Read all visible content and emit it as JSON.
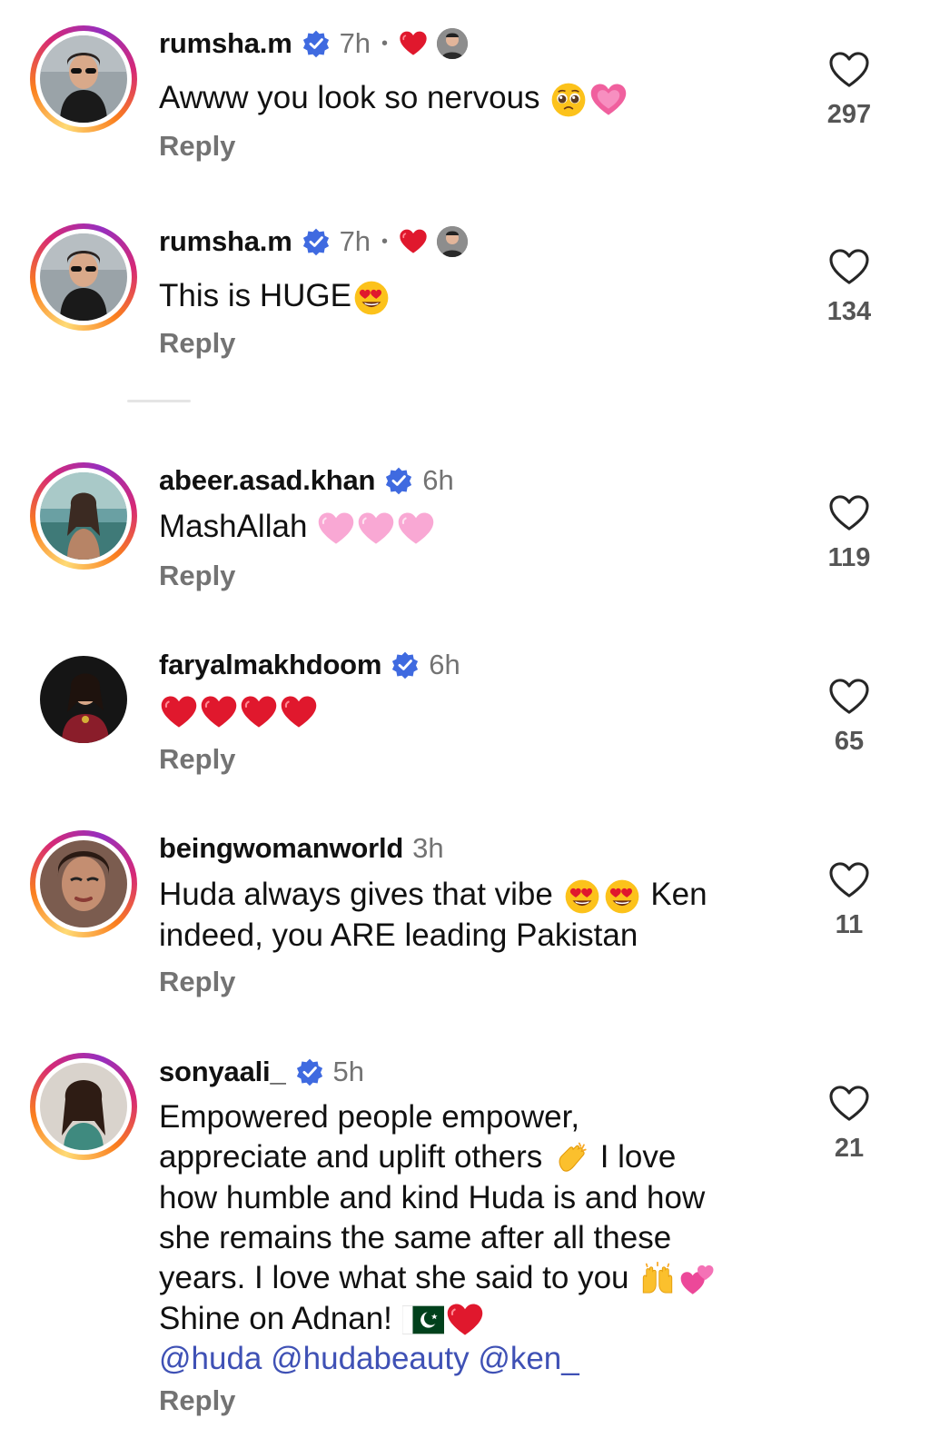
{
  "comments": [
    {
      "username": "rumsha.m",
      "verified": true,
      "time": "7h",
      "separator": "•",
      "creator_liked": true,
      "text": "Awww you look so nervous",
      "emojis": [
        "pleading-face-emoji",
        "growing-heart-emoji"
      ],
      "reply_label": "Reply",
      "likes": "297",
      "avatar_ring": "story"
    },
    {
      "username": "rumsha.m",
      "verified": true,
      "time": "7h",
      "separator": "•",
      "creator_liked": true,
      "text": "This is HUGE",
      "emojis": [
        "heart-eyes-emoji"
      ],
      "reply_label": "Reply",
      "likes": "134",
      "avatar_ring": "story"
    },
    {
      "username": "abeer.asad.khan",
      "verified": true,
      "time": "6h",
      "text": "MashAllah",
      "emojis": [
        "pink-heart-emoji",
        "pink-heart-emoji",
        "pink-heart-emoji"
      ],
      "reply_label": "Reply",
      "likes": "119",
      "avatar_ring": "story"
    },
    {
      "username": "faryalmakhdoom",
      "verified": true,
      "time": "6h",
      "text": "",
      "emojis": [
        "red-heart-emoji",
        "red-heart-emoji",
        "red-heart-emoji",
        "red-heart-emoji"
      ],
      "reply_label": "Reply",
      "likes": "65",
      "avatar_ring": "none"
    },
    {
      "username": "beingwomanworld",
      "verified": false,
      "time": "3h",
      "text_parts": [
        "Huda always gives that vibe",
        "Ken indeed, you ARE leading Pakistan"
      ],
      "reply_label": "Reply",
      "likes": "11",
      "avatar_ring": "story"
    },
    {
      "username": "sonyaali_",
      "verified": true,
      "time": "5h",
      "text_lines": [
        "Empowered people empower,",
        "appreciate and uplift others",
        "I love",
        "how humble and kind Huda is and how",
        "she remains the same after all these",
        "years. I love what she said to you",
        "Shine on Adnan!"
      ],
      "mentions": "@huda @hudabeauty @ken_",
      "reply_label": "Reply",
      "likes": "21",
      "avatar_ring": "story"
    }
  ],
  "colors": {
    "text": "#111111",
    "meta": "#737373",
    "verified_blue": "#3f6ae0",
    "mention_blue": "#3f51b5",
    "heart_red": "#e0182d"
  }
}
